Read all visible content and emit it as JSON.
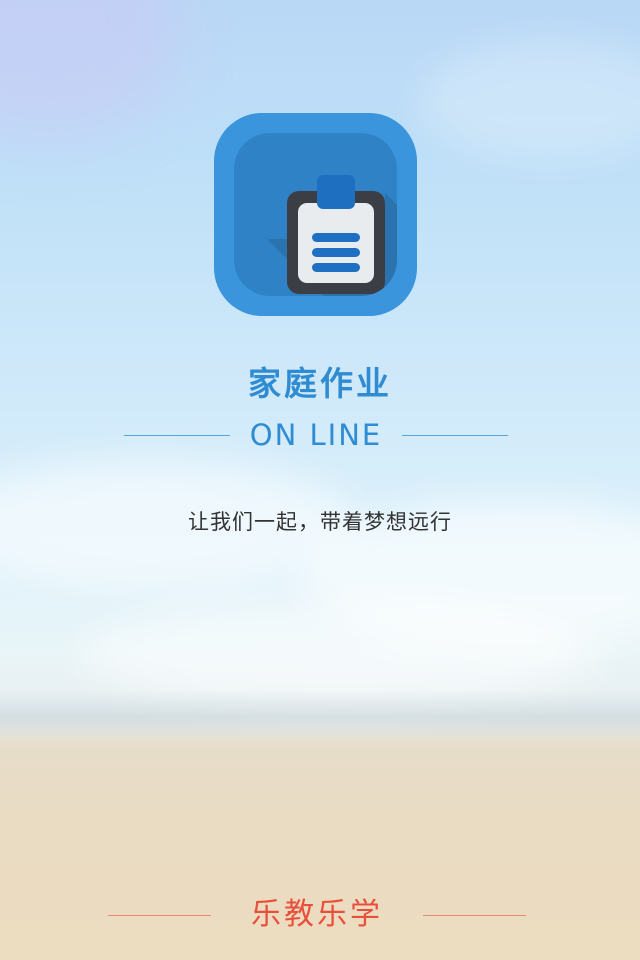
{
  "app": {
    "title": "家庭作业",
    "subtitle": "ON LINE",
    "slogan": "让我们一起，带着梦想远行",
    "footer": "乐教乐学",
    "icon_name": "clipboard-icon"
  },
  "colors": {
    "accent": "#2f8cd3",
    "icon_background": "#3a95dc",
    "footer_text": "#e8503c",
    "slogan_text": "#333333"
  }
}
